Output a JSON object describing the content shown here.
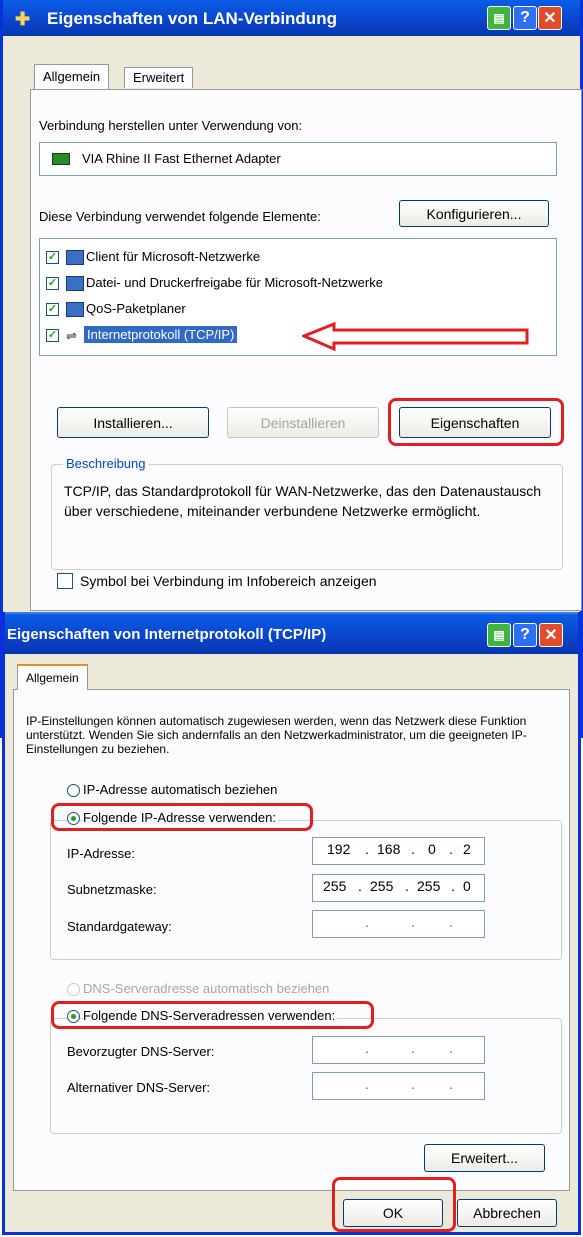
{
  "dialog1": {
    "title": "Eigenschaften von LAN-Verbindung",
    "tabs": [
      "Allgemein",
      "Erweitert"
    ],
    "connect_using_label": "Verbindung herstellen unter Verwendung von:",
    "adapter_name": "VIA Rhine II Fast Ethernet Adapter",
    "configure_button": "Konfigurieren...",
    "components_label": "Diese Verbindung verwendet folgende Elemente:",
    "components": [
      {
        "label": "Client für Microsoft-Netzwerke",
        "checked": true,
        "icon": "network-client-icon"
      },
      {
        "label": "Datei- und Druckerfreigabe für Microsoft-Netzwerke",
        "checked": true,
        "icon": "file-print-sharing-icon"
      },
      {
        "label": "QoS-Paketplaner",
        "checked": true,
        "icon": "qos-icon"
      },
      {
        "label": "Internetprotokoll (TCP/IP)",
        "checked": true,
        "icon": "protocol-icon",
        "selected": true
      }
    ],
    "install_button": "Installieren...",
    "uninstall_button": "Deinstallieren",
    "properties_button": "Eigenschaften",
    "description_title": "Beschreibung",
    "description_text": "TCP/IP, das Standardprotokoll für WAN-Netzwerke, das den Datenaustausch über verschiedene, miteinander verbundene Netzwerke ermöglicht.",
    "show_icon_label": "Symbol bei Verbindung im Infobereich anzeigen"
  },
  "dialog2": {
    "title": "Eigenschaften von Internetprotokoll (TCP/IP)",
    "tab": "Allgemein",
    "intro_text": "IP-Einstellungen können automatisch zugewiesen werden, wenn das Netzwerk diese Funktion unterstützt. Wenden Sie sich andernfalls an den Netzwerkadministrator, um die geeigneten IP-Einstellungen zu beziehen.",
    "auto_ip_label": "IP-Adresse automatisch beziehen",
    "manual_ip_label": "Folgende IP-Adresse verwenden:",
    "ip_label": "IP-Adresse:",
    "ip_value": [
      "192",
      "168",
      "0",
      "2"
    ],
    "subnet_label": "Subnetzmaske:",
    "subnet_value": [
      "255",
      "255",
      "255",
      "0"
    ],
    "gateway_label": "Standardgateway:",
    "auto_dns_label": "DNS-Serveradresse automatisch beziehen",
    "manual_dns_label": "Folgende DNS-Serveradressen verwenden:",
    "preferred_dns_label": "Bevorzugter DNS-Server:",
    "alternate_dns_label": "Alternativer DNS-Server:",
    "advanced_button": "Erweitert...",
    "ok_button": "OK",
    "cancel_button": "Abbrechen"
  },
  "colors": {
    "titlebar": "#0a43c9",
    "dialog_bg": "#ece9d8",
    "panel_bg": "#fcfcfe",
    "highlight": "#e02020",
    "selection": "#316ac5",
    "close_button": "#e34b2a"
  }
}
